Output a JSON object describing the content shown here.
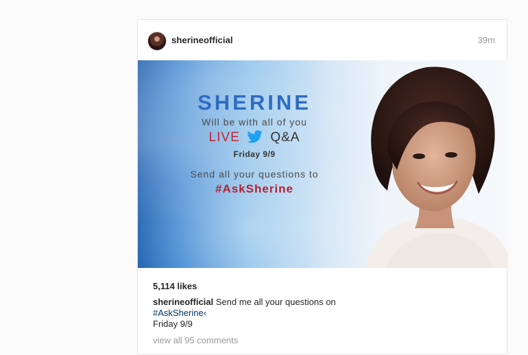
{
  "post": {
    "username": "sherineofficial",
    "timestamp": "39m",
    "image": {
      "headline": "SHERINE",
      "line1": "Will be with all of you",
      "live": "LIVE",
      "qa": "Q&A",
      "date": "Friday 9/9",
      "send_line": "Send all your questions to",
      "hashtag": "#AskSherine",
      "twitter_icon": "twitter-bird-icon"
    },
    "likes": "5,114 likes",
    "caption": {
      "username": "sherineofficial",
      "text": "Send me all your questions on",
      "hashtag": "#AskSherine‹",
      "date": "Friday 9/9"
    },
    "view_comments": "view all 95 comments",
    "colors": {
      "headline": "#2e6cc2",
      "live": "#c0262d",
      "hashtag_image": "#b8212b",
      "link": "#003569",
      "muted": "#999999"
    }
  }
}
